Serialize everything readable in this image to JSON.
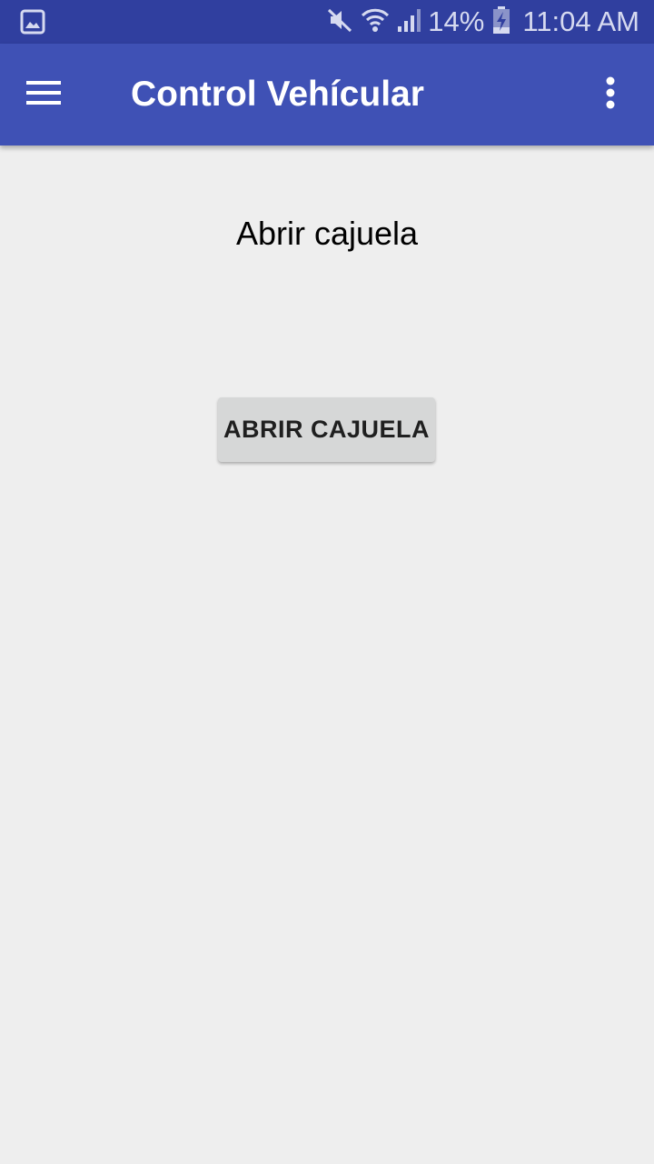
{
  "status_bar": {
    "left_icons": [
      "gallery-icon"
    ],
    "right_icons": [
      "mute-icon",
      "wifi-icon",
      "signal-icon",
      "battery-charging-icon"
    ],
    "battery_percent": "14%",
    "time": "11:04 AM"
  },
  "app_bar": {
    "title": "Control Vehícular",
    "nav_icon": "hamburger-menu-icon",
    "overflow_icon": "more-vert-icon"
  },
  "main": {
    "heading": "Abrir cajuela",
    "button_label": "ABRIR CAJUELA"
  },
  "colors": {
    "status_bar": "#303f9f",
    "app_bar": "#3f51b5",
    "background": "#eeeeee",
    "button": "#d6d7d7",
    "button_text": "#1f1f1f"
  }
}
